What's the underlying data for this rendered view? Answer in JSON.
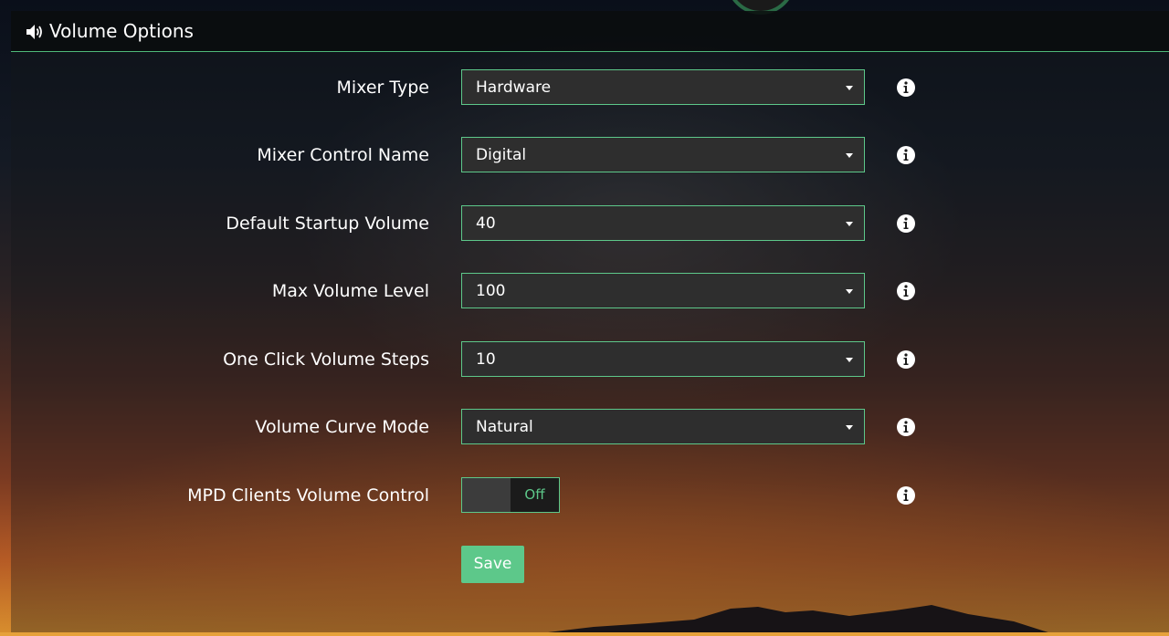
{
  "header": {
    "title": "Volume Options",
    "icon": "speaker-icon"
  },
  "settings": [
    {
      "label": "Mixer Type",
      "type": "select",
      "value": "Hardware"
    },
    {
      "label": "Mixer Control Name",
      "type": "select",
      "value": "Digital"
    },
    {
      "label": "Default Startup Volume",
      "type": "select",
      "value": "40"
    },
    {
      "label": "Max Volume Level",
      "type": "select",
      "value": "100"
    },
    {
      "label": "One Click Volume Steps",
      "type": "select",
      "value": "10"
    },
    {
      "label": "Volume Curve Mode",
      "type": "select",
      "value": "Natural"
    },
    {
      "label": "MPD Clients Volume Control",
      "type": "toggle",
      "value": "Off"
    }
  ],
  "actions": {
    "save_label": "Save"
  },
  "colors": {
    "accent": "#5dc88a",
    "select_bg": "#2e2e2e",
    "header_bg": "#0a0c0e"
  },
  "icons": {
    "info": "info-icon",
    "caret": "caret-down-icon"
  }
}
